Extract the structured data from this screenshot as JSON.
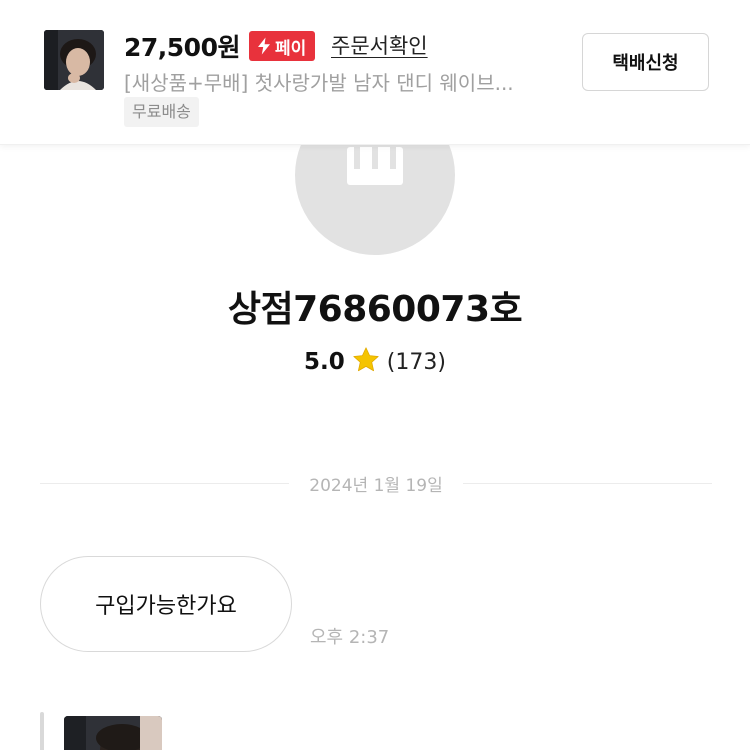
{
  "product": {
    "price": "27,500원",
    "pay_badge": "페이",
    "order_link": "주문서확인",
    "title": "[새상품+무배] 첫사랑가발 남자 댄디 웨이브...",
    "shipping_tag": "무료배송",
    "delivery_button": "택배신청"
  },
  "shop": {
    "name": "상점76860073호",
    "rating": "5.0",
    "review_count": "(173)"
  },
  "chat": {
    "date": "2024년 1월 19일",
    "messages": [
      {
        "text": "구입가능한가요",
        "time": "오후 2:37"
      }
    ]
  },
  "colors": {
    "pay_red": "#e8323c",
    "star": "#f5c400",
    "avatar_gray": "#e2e2e2"
  },
  "icons": {
    "pay": "lightning-icon",
    "rating": "star-icon",
    "shop": "storefront-icon"
  }
}
